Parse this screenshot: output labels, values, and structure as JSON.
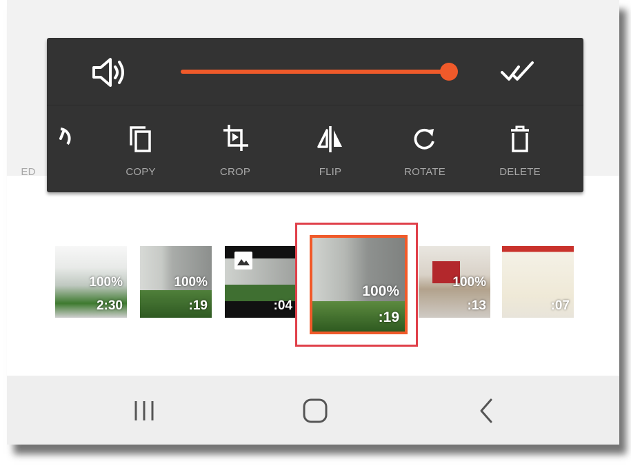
{
  "volume": {
    "icon": "volume-icon",
    "level_fraction": 1.0,
    "accent_color": "#f05a2a"
  },
  "done": {
    "icon": "double-check-icon"
  },
  "tools": [
    {
      "label": "ED",
      "icon": "speed-icon"
    },
    {
      "label": "COPY",
      "icon": "copy-icon"
    },
    {
      "label": "CROP",
      "icon": "crop-icon"
    },
    {
      "label": "FLIP",
      "icon": "flip-icon"
    },
    {
      "label": "ROTATE",
      "icon": "rotate-icon"
    },
    {
      "label": "DELETE",
      "icon": "trash-icon"
    }
  ],
  "thumbnails": [
    {
      "percent": "100%",
      "duration": "2:30"
    },
    {
      "percent": "100%",
      "duration": ":19"
    },
    {
      "percent": "",
      "duration": ":04",
      "badge_icon": "image-icon"
    },
    {
      "percent": "100%",
      "duration": ":19",
      "selected": true
    },
    {
      "percent": "100%",
      "duration": ":13"
    },
    {
      "percent": "",
      "duration": ":07"
    }
  ],
  "navbar": {
    "recents_icon": "recents-icon",
    "home_icon": "home-icon",
    "back_icon": "back-icon"
  }
}
